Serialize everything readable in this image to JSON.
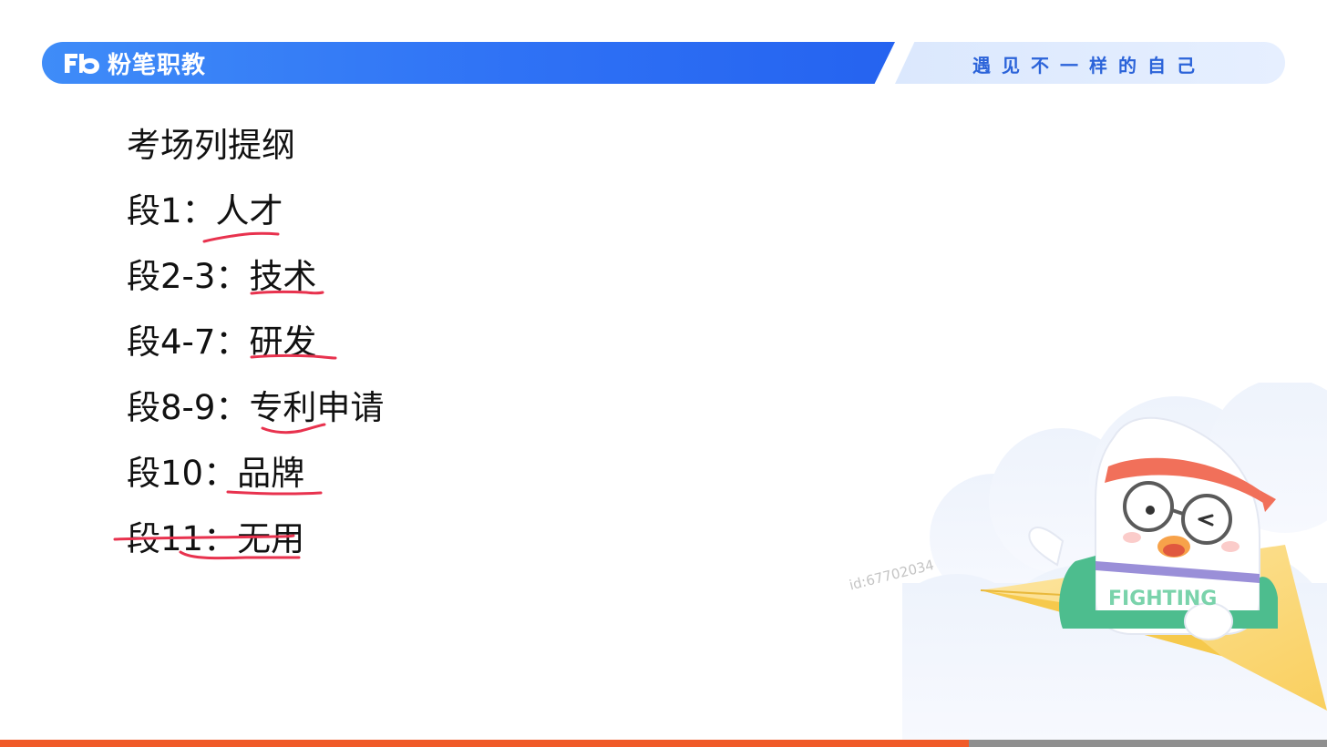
{
  "header": {
    "logo_text": "粉笔职教",
    "slogan": "遇见不一样的自己"
  },
  "outline": {
    "title": "考场列提纲",
    "items": [
      {
        "para": "段1：",
        "topic": "人才"
      },
      {
        "para": "段2-3：",
        "topic": "技术"
      },
      {
        "para": "段4-7：",
        "topic": "研发"
      },
      {
        "para": "段8-9：",
        "topic": "专利申请"
      },
      {
        "para": "段10：",
        "topic": "品牌"
      },
      {
        "para": "段11：",
        "topic": "无用"
      }
    ]
  },
  "watermark": "id:67702034",
  "mascot": {
    "badge_text": "FIGHTING"
  },
  "progress": {
    "fraction": 0.73
  },
  "colors": {
    "brand_blue": "#2f72f5",
    "slogan_blue": "#2b63d9",
    "annotation_red": "#e8324e",
    "progress_orange": "#f05a28"
  }
}
